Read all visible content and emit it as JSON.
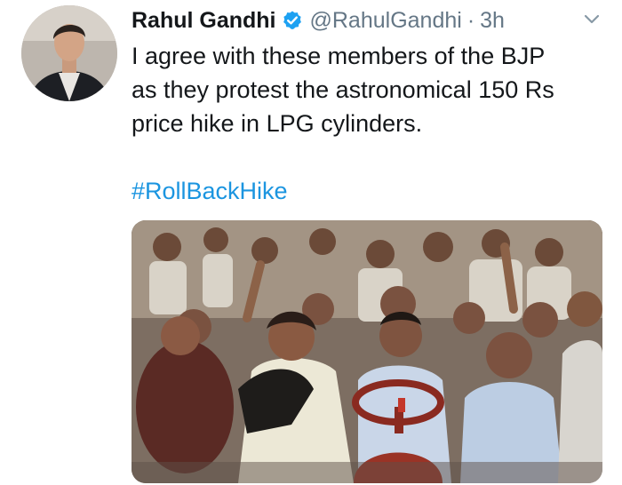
{
  "tweet": {
    "author_name": "Rahul Gandhi",
    "handle": "@RahulGandhi",
    "separator": "·",
    "time": "3h",
    "text": "I agree with these members of the BJP\nas they protest the astronomical 150 Rs\nprice hike in LPG cylinders.",
    "hashtag": "#RollBackHike"
  },
  "icons": {
    "verified": "verified-badge-icon",
    "menu": "chevron-down-icon"
  },
  "colors": {
    "name": "#14171a",
    "meta": "#657786",
    "link": "#1b95e0",
    "verified": "#1da1f2"
  }
}
